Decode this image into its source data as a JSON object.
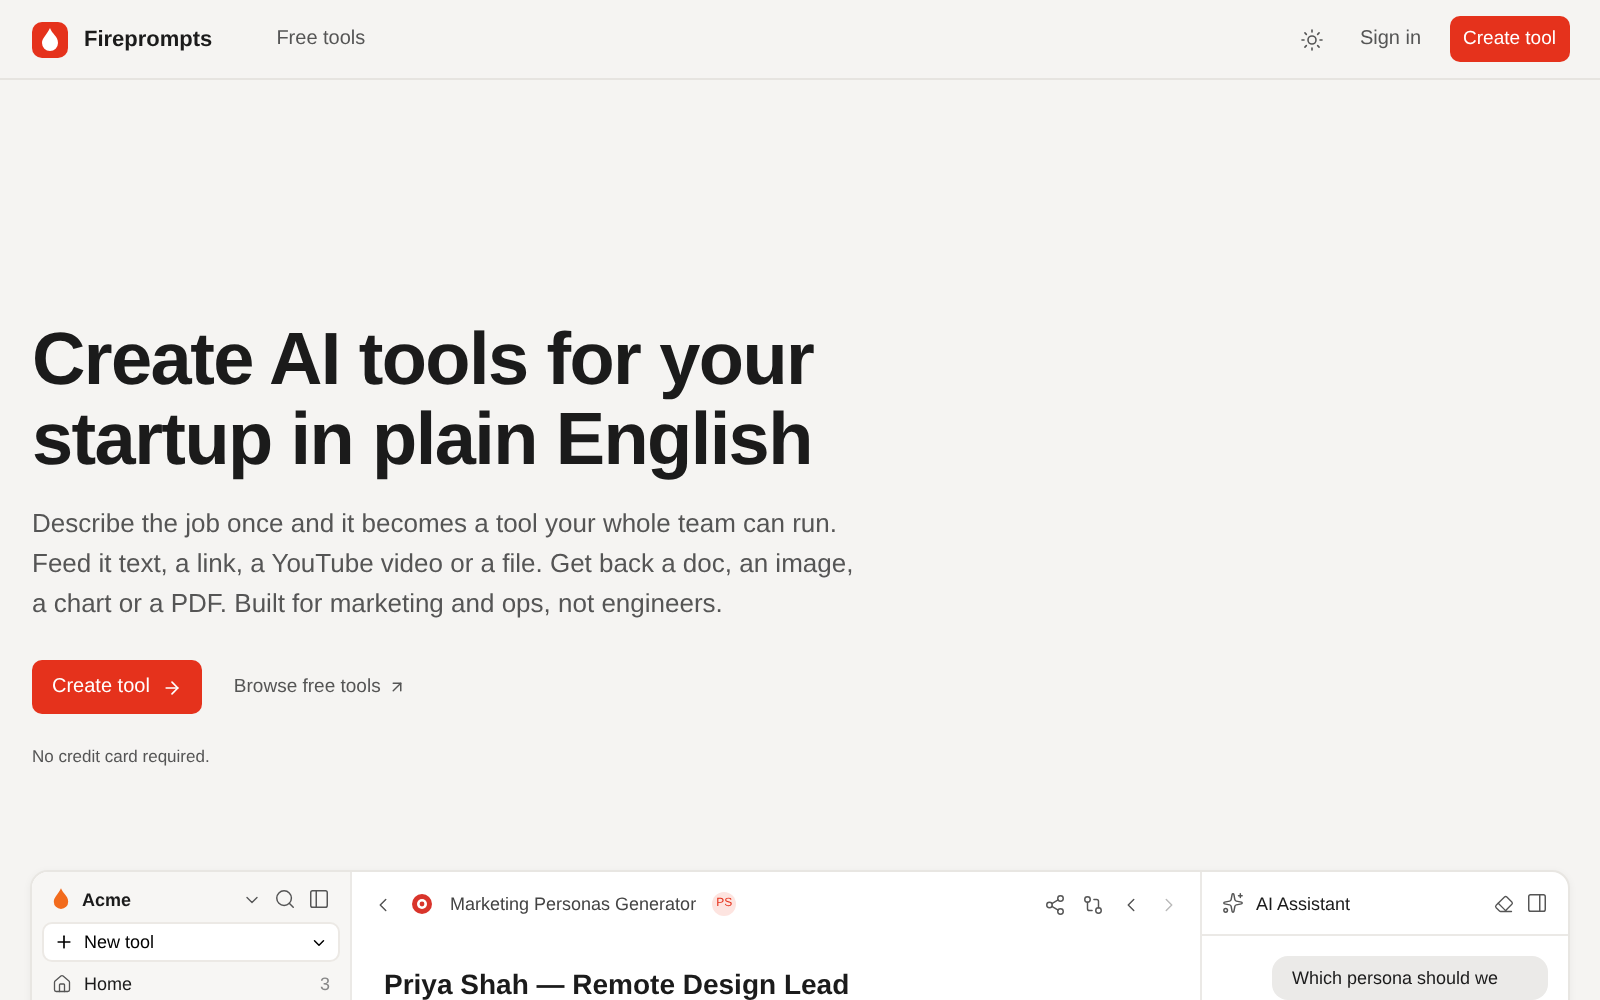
{
  "header": {
    "brand": "Fireprompts",
    "nav": [
      {
        "label": "Free tools"
      }
    ],
    "sign_in": "Sign in",
    "cta": "Create tool"
  },
  "hero": {
    "title_lines": [
      "Create AI tools for your",
      "startup in plain English"
    ],
    "description": "Describe the job once and it becomes a tool your whole team can run. Feed it text, a link, a YouTube video or a file. Get back a doc, an image, a chart or a PDF. Built for marketing and ops, not engineers.",
    "primary": "Create tool",
    "secondary": "Browse free tools",
    "note": "No credit card required."
  },
  "app": {
    "sidebar": {
      "workspace": "Acme",
      "new_tool": "New tool",
      "items": [
        {
          "label": "Home",
          "count": "3"
        }
      ]
    },
    "main": {
      "tool_name": "Marketing Personas Generator",
      "badge": "PS",
      "heading": "Priya Shah — Remote Design Lead"
    },
    "assistant": {
      "title": "AI Assistant",
      "messages": [
        {
          "text": "Which persona should we"
        }
      ]
    }
  }
}
